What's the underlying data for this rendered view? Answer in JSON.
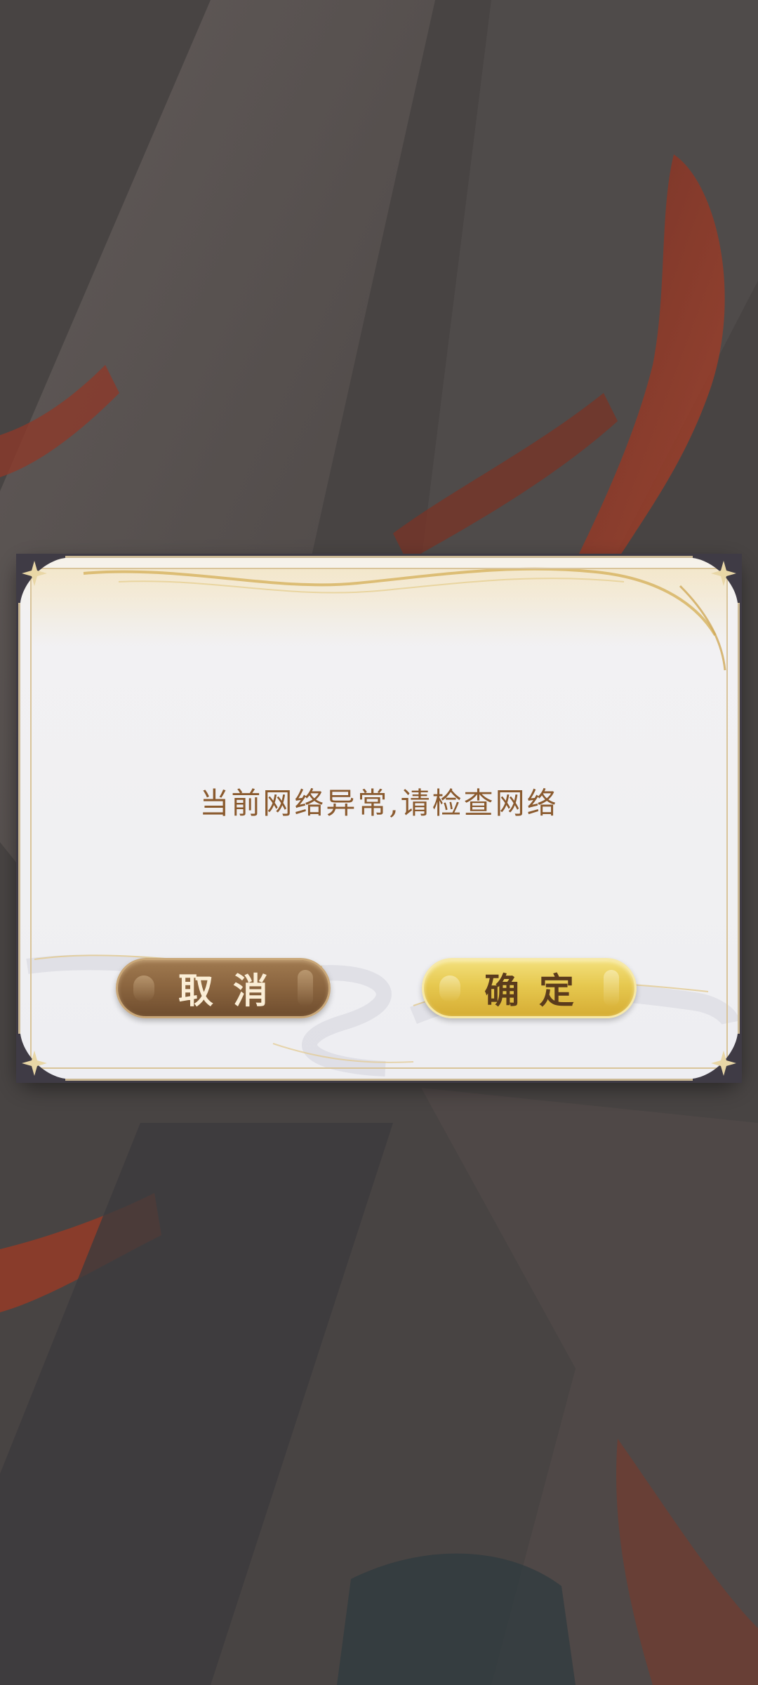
{
  "dialog": {
    "message": "当前网络异常,请检查网络",
    "cancel_label": "取消",
    "confirm_label": "确定"
  },
  "colors": {
    "message_text": "#8a5a2e",
    "cancel_button": "#8c6640",
    "confirm_button": "#e6c84f",
    "frame_gold": "#cbb995",
    "frame_dark": "#3f3b45"
  },
  "icons": {
    "corner": "star-corner-ornament-icon"
  }
}
